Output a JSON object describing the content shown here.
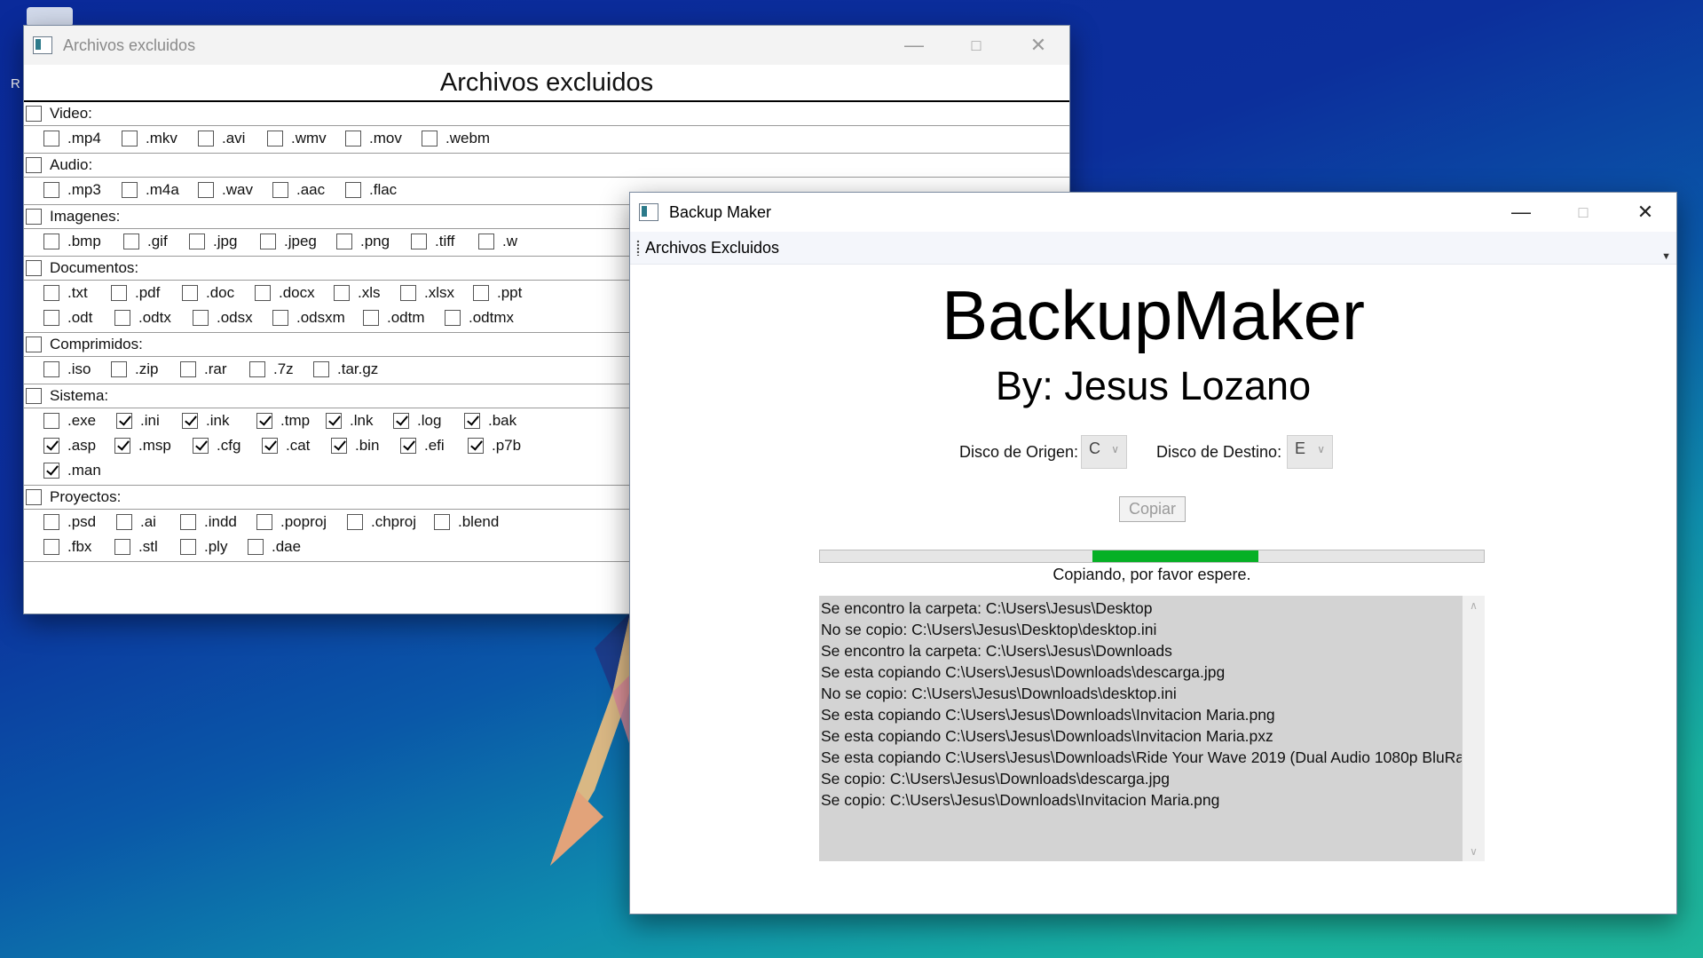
{
  "desktop": {
    "partial_label": "R"
  },
  "excluded_window": {
    "title": "Archivos excluidos",
    "heading": "Archivos excluidos",
    "categories": [
      {
        "label": "Video:",
        "checked": false,
        "rows": [
          [
            ".mp4",
            ".mkv",
            ".avi",
            ".wmv",
            ".mov",
            ".webm"
          ]
        ]
      },
      {
        "label": "Audio:",
        "checked": false,
        "rows": [
          [
            ".mp3",
            ".m4a",
            ".wav",
            ".aac",
            ".flac"
          ]
        ]
      },
      {
        "label": "Imagenes:",
        "checked": false,
        "rows": [
          [
            ".bmp",
            ".gif",
            ".jpg",
            ".jpeg",
            ".png",
            ".tiff",
            ".w"
          ]
        ]
      },
      {
        "label": "Documentos:",
        "checked": false,
        "rows": [
          [
            ".txt",
            ".pdf",
            ".doc",
            ".docx",
            ".xls",
            ".xlsx",
            ".ppt"
          ],
          [
            ".odt",
            ".odtx",
            ".odsx",
            ".odsxm",
            ".odtm",
            ".odtmx"
          ]
        ]
      },
      {
        "label": "Comprimidos:",
        "checked": false,
        "rows": [
          [
            ".iso",
            ".zip",
            ".rar",
            ".7z",
            ".tar.gz"
          ]
        ]
      },
      {
        "label": "Sistema:",
        "checked": false,
        "rows": [
          [
            ".exe",
            ".ini",
            ".ink",
            ".tmp",
            ".lnk",
            ".log",
            ".bak"
          ],
          [
            ".asp",
            ".msp",
            ".cfg",
            ".cat",
            ".bin",
            ".efi",
            ".p7b"
          ],
          [
            ".man"
          ]
        ]
      },
      {
        "label": "Proyectos:",
        "checked": false,
        "rows": [
          [
            ".psd",
            ".ai",
            ".indd",
            ".poproj",
            ".chproj",
            ".blend"
          ],
          [
            ".fbx",
            ".stl",
            ".ply",
            ".dae"
          ]
        ]
      }
    ],
    "checked_extensions": [
      ".ini",
      ".ink",
      ".tmp",
      ".lnk",
      ".log",
      ".bak",
      ".asp",
      ".msp",
      ".cfg",
      ".cat",
      ".bin",
      ".efi",
      ".p7b",
      ".man"
    ]
  },
  "backup_window": {
    "title": "Backup Maker",
    "menu": {
      "item": "Archivos Excluidos"
    },
    "app_title": "BackupMaker",
    "author": "By: Jesus Lozano",
    "origin_label": "Disco de Origen:",
    "origin_value": "C",
    "dest_label": "Disco de Destino:",
    "dest_value": "E",
    "copy_button": "Copiar",
    "progress": {
      "start": 0.41,
      "end": 0.66
    },
    "status": "Copiando, por favor espere.",
    "log": [
      "Se encontro la carpeta: C:\\Users\\Jesus\\Desktop",
      "No se copio: C:\\Users\\Jesus\\Desktop\\desktop.ini",
      "Se encontro la carpeta: C:\\Users\\Jesus\\Downloads",
      "Se esta copiando C:\\Users\\Jesus\\Downloads\\descarga.jpg",
      "No se copio: C:\\Users\\Jesus\\Downloads\\desktop.ini",
      "Se esta copiando C:\\Users\\Jesus\\Downloads\\Invitacion Maria.png",
      "Se esta copiando C:\\Users\\Jesus\\Downloads\\Invitacion Maria.pxz",
      "Se esta copiando C:\\Users\\Jesus\\Downloads\\Ride Your Wave 2019 (Dual Audio 1080p BluRa",
      "Se copio: C:\\Users\\Jesus\\Downloads\\descarga.jpg",
      "Se copio: C:\\Users\\Jesus\\Downloads\\Invitacion Maria.png"
    ]
  }
}
